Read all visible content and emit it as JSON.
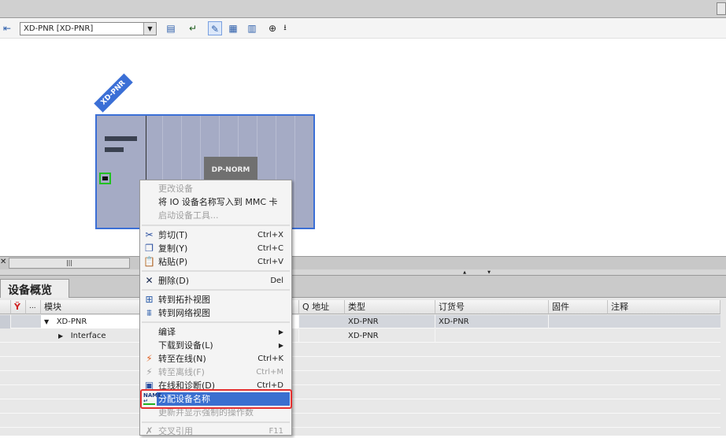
{
  "toolbar": {
    "device_select": "XD-PNR [XD-PNR]"
  },
  "device": {
    "label": "XD-PNR",
    "module": "DP-NORM"
  },
  "tab": {
    "label": "设备概览"
  },
  "table": {
    "headers": {
      "dots": "...",
      "module": "模块",
      "q_address": "Q 地址",
      "type": "类型",
      "order_no": "订货号",
      "firmware": "固件",
      "comment": "注释"
    },
    "rows": [
      {
        "module": "XD-PNR",
        "type": "XD-PNR",
        "order_no": "XD-PNR"
      },
      {
        "module": "Interface",
        "type": "XD-PNR",
        "order_no": ""
      }
    ]
  },
  "menu": {
    "items": [
      {
        "label": "更改设备"
      },
      {
        "label": "将 IO 设备名称写入到 MMC 卡"
      },
      {
        "label": "启动设备工具..."
      },
      {
        "label": "剪切(T)",
        "shortcut": "Ctrl+X"
      },
      {
        "label": "复制(Y)",
        "shortcut": "Ctrl+C"
      },
      {
        "label": "粘贴(P)",
        "shortcut": "Ctrl+V"
      },
      {
        "label": "删除(D)",
        "shortcut": "Del"
      },
      {
        "label": "转到拓扑视图"
      },
      {
        "label": "转到网络视图"
      },
      {
        "label": "编译"
      },
      {
        "label": "下载到设备(L)"
      },
      {
        "label": "转至在线(N)",
        "shortcut": "Ctrl+K"
      },
      {
        "label": "转至离线(F)",
        "shortcut": "Ctrl+M"
      },
      {
        "label": "在线和诊断(D)",
        "shortcut": "Ctrl+D"
      },
      {
        "label": "分配设备名称"
      },
      {
        "label": "更新并显示强制的操作数"
      },
      {
        "label": "交叉引用",
        "shortcut": "F11"
      }
    ]
  },
  "colors": {
    "accent": "#3a6fd0",
    "highlight_box": "#e53030",
    "rack": "#a5abc5"
  }
}
